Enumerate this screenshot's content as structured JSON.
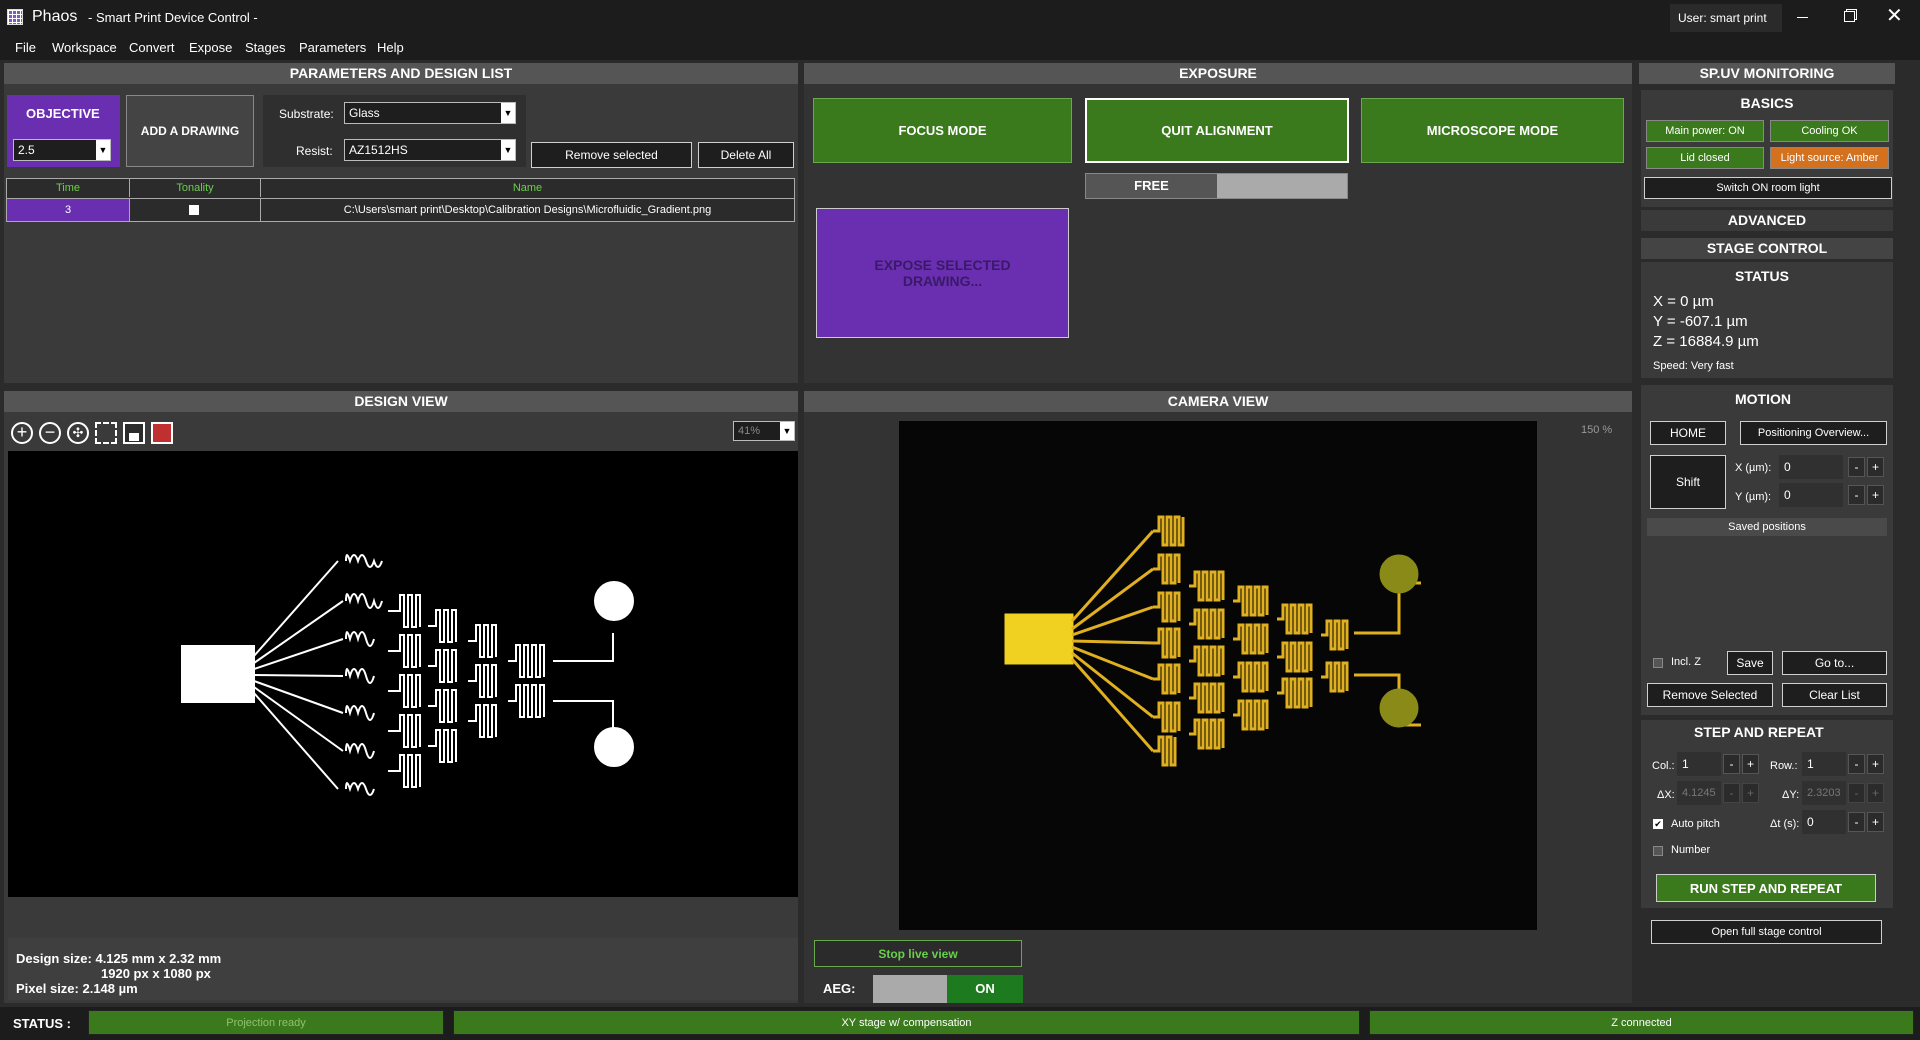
{
  "app": {
    "name": "Phaos",
    "subtitle": "- Smart Print Device Control -",
    "user": "User: smart print"
  },
  "menu": [
    "File",
    "Workspace",
    "Convert",
    "Expose",
    "Stages",
    "Parameters",
    "Help"
  ],
  "params": {
    "title": "PARAMETERS AND DESIGN LIST",
    "objective_label": "OBJECTIVE",
    "objective_value": "2.5",
    "add_drawing": "ADD A DRAWING",
    "substrate_label": "Substrate:",
    "substrate_value": "Glass",
    "resist_label": "Resist:",
    "resist_value": "AZ1512HS",
    "remove_selected": "Remove selected",
    "delete_all": "Delete All",
    "table_headers": [
      "Time",
      "Tonality",
      "Name"
    ],
    "rows": [
      {
        "time": "3",
        "name": "C:\\Users\\smart print\\Desktop\\Calibration Designs\\Microfluidic_Gradient.png"
      }
    ]
  },
  "exposure": {
    "title": "EXPOSURE",
    "focus_mode": "FOCUS MODE",
    "quit_alignment": "QUIT ALIGNMENT",
    "microscope_mode": "MICROSCOPE MODE",
    "free_label": "FREE",
    "expose_selected": "EXPOSE SELECTED DRAWING..."
  },
  "design_view": {
    "title": "DESIGN VIEW",
    "zoom": "41%",
    "size_line1": "Design size: 4.125 mm x 2.32 mm",
    "size_line2": "1920 px x 1080 px",
    "pixel_size": "Pixel size: 2.148 µm"
  },
  "camera_view": {
    "title": "CAMERA VIEW",
    "zoom": "150 %",
    "stop_live": "Stop live view",
    "aeg_label": "AEG:",
    "aeg_state": "ON"
  },
  "monitoring": {
    "title": "SP.UV MONITORING",
    "basics": "BASICS",
    "main_power": "Main power: ON",
    "cooling": "Cooling OK",
    "lid": "Lid closed",
    "light_source": "Light source: Amber",
    "room_light": "Switch ON room light",
    "advanced": "ADVANCED",
    "stage_control": "STAGE CONTROL",
    "status": "STATUS",
    "x": "X = 0 µm",
    "y": "Y = -607.1 µm",
    "z": "Z = 16884.9 µm",
    "speed": "Speed: Very fast",
    "motion": "MOTION",
    "home": "HOME",
    "pos_overview": "Positioning Overview...",
    "shift": "Shift",
    "x_label": "X (µm):",
    "x_value": "0",
    "y_label": "Y (µm):",
    "y_value": "0",
    "saved_positions": "Saved positions",
    "incl_z": "Incl. Z",
    "save": "Save",
    "go_to": "Go to...",
    "remove_selected": "Remove Selected",
    "clear_list": "Clear List",
    "step_repeat": "STEP AND REPEAT",
    "col_label": "Col.:",
    "col_value": "1",
    "row_label": "Row.:",
    "row_value": "1",
    "dx_label": "ΔX:",
    "dx_value": "4.1245",
    "dy_label": "ΔY:",
    "dy_value": "2.3203",
    "auto_pitch": "Auto pitch",
    "dt_label": "Δt (s):",
    "dt_value": "0",
    "number": "Number",
    "run": "RUN STEP AND REPEAT",
    "open_full": "Open full stage control"
  },
  "statusbar": {
    "label": "STATUS :",
    "projection": "Projection ready",
    "xy": "XY stage w/ compensation",
    "z": "Z connected"
  },
  "colors": {
    "green": "#3a7a1c",
    "purple": "#6a2fb0",
    "orange": "#d4711f",
    "panel": "#303030"
  }
}
